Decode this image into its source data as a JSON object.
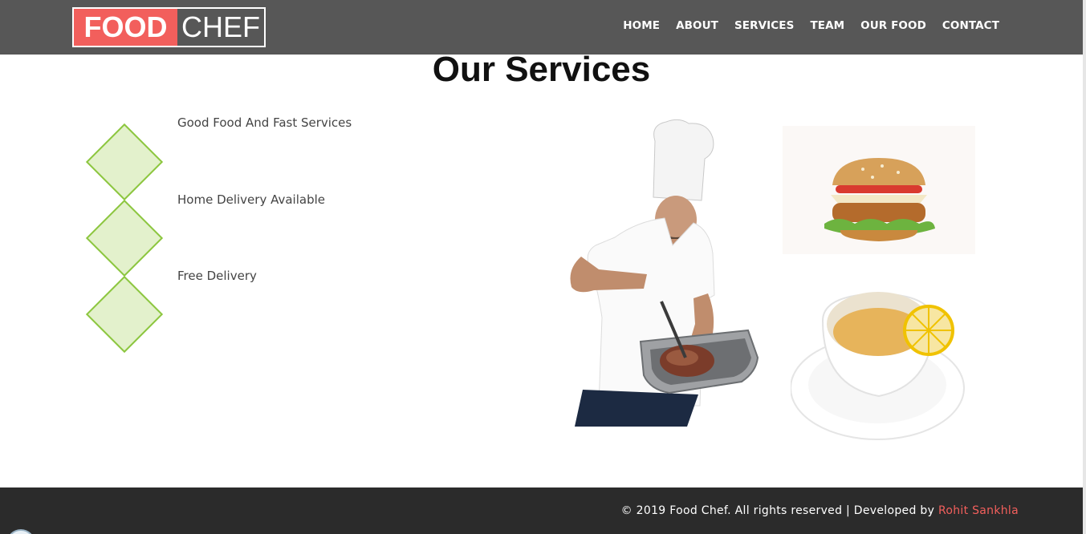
{
  "header": {
    "logo_primary": "FOOD",
    "logo_secondary": "CHEF",
    "nav": [
      {
        "label": "HOME"
      },
      {
        "label": "ABOUT"
      },
      {
        "label": "SERVICES"
      },
      {
        "label": "TEAM"
      },
      {
        "label": "OUR FOOD"
      },
      {
        "label": "CONTACT"
      }
    ]
  },
  "services": {
    "title": "Our Services",
    "items": [
      {
        "label": "Good Food And Fast Services",
        "icon": "diamond-icon"
      },
      {
        "label": "Home Delivery Available",
        "icon": "diamond-icon"
      },
      {
        "label": "Free Delivery",
        "icon": "diamond-icon"
      }
    ],
    "images": [
      "chef-image",
      "burger-image",
      "tea-image"
    ]
  },
  "footer": {
    "copyright": "© 2019 Food Chef. All rights reserved | Developed by",
    "developer": "Rohit Sankhla"
  },
  "colors": {
    "header_bg": "#575757",
    "logo_accent": "#f25f5c",
    "diamond_fill": "#e3f1cc",
    "diamond_border": "#8cc63f",
    "footer_bg": "#2b2b2b",
    "link_color": "#f25f5c"
  }
}
